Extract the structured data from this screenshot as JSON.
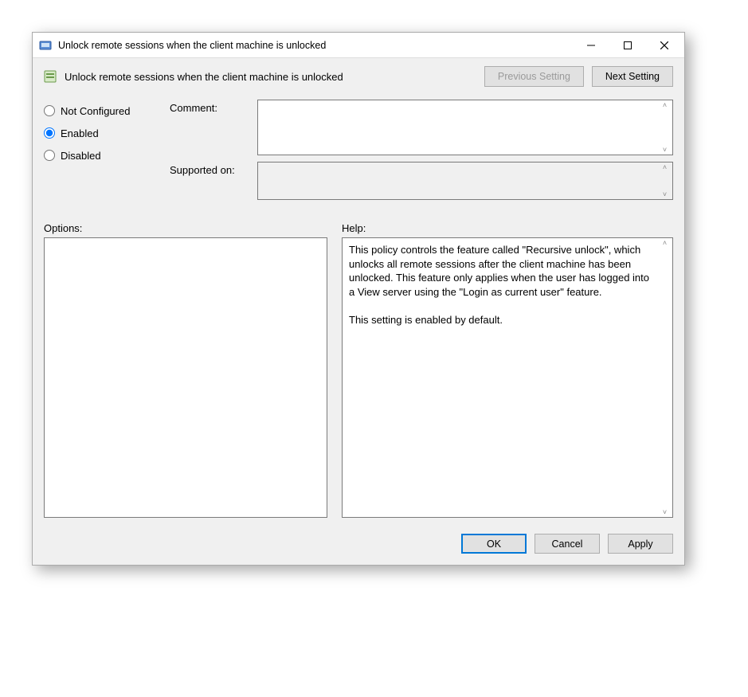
{
  "window": {
    "title": "Unlock remote sessions when the client machine is unlocked"
  },
  "header": {
    "title": "Unlock remote sessions when the client machine is unlocked",
    "prev_button": "Previous Setting",
    "next_button": "Next Setting"
  },
  "state": {
    "radios": {
      "not_configured": "Not Configured",
      "enabled": "Enabled",
      "disabled": "Disabled",
      "selected": "enabled"
    },
    "comment_label": "Comment:",
    "comment_value": "",
    "supported_label": "Supported on:",
    "supported_value": ""
  },
  "panes": {
    "options_label": "Options:",
    "help_label": "Help:",
    "options_text": "",
    "help_text": "This policy controls the feature called \"Recursive unlock\", which unlocks all remote sessions after the client machine has been unlocked. This feature only applies when the user has logged into a View server using the \"Login as current user\" feature.\n\nThis setting is enabled by default."
  },
  "footer": {
    "ok": "OK",
    "cancel": "Cancel",
    "apply": "Apply"
  }
}
